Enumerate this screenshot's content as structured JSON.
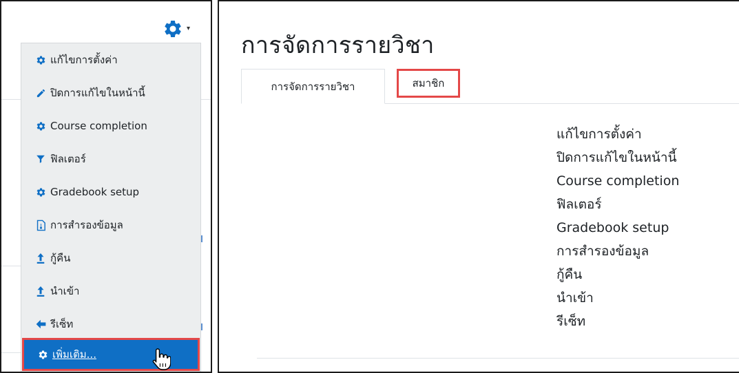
{
  "settings_menu": {
    "trigger_icon": "gear-icon",
    "caret_glyph": "▾",
    "accent_color": "#0f6fc5",
    "items": [
      {
        "label": "แก้ไขการตั้งค่า",
        "icon": "gear-icon"
      },
      {
        "label": "ปิดการแก้ไขในหน้านี้",
        "icon": "pencil-icon"
      },
      {
        "label": "Course completion",
        "icon": "gear-icon"
      },
      {
        "label": "ฟิลเตอร์",
        "icon": "filter-icon"
      },
      {
        "label": "Gradebook setup",
        "icon": "gear-icon"
      },
      {
        "label": "การสำรองข้อมูล",
        "icon": "backup-file-icon"
      },
      {
        "label": "กู้คืน",
        "icon": "upload-arrow-icon"
      },
      {
        "label": "นำเข้า",
        "icon": "upload-arrow-icon"
      },
      {
        "label": "รีเซ็ท",
        "icon": "left-arrow-icon"
      },
      {
        "label": "เพิ่มเติม...",
        "icon": "gear-icon",
        "highlighted": true
      }
    ]
  },
  "course_admin": {
    "title": "การจัดการรายวิชา",
    "tabs": [
      {
        "label": "การจัดการรายวิชา",
        "active": true
      },
      {
        "label": "สมาชิก",
        "highlighted": true
      }
    ],
    "links": [
      "แก้ไขการตั้งค่า",
      "ปิดการแก้ไขในหน้านี้",
      "Course completion",
      "ฟิลเตอร์",
      "Gradebook setup",
      "การสำรองข้อมูล",
      "กู้คืน",
      "นำเข้า",
      "รีเซ็ท"
    ]
  },
  "highlight_color": "#e44848"
}
